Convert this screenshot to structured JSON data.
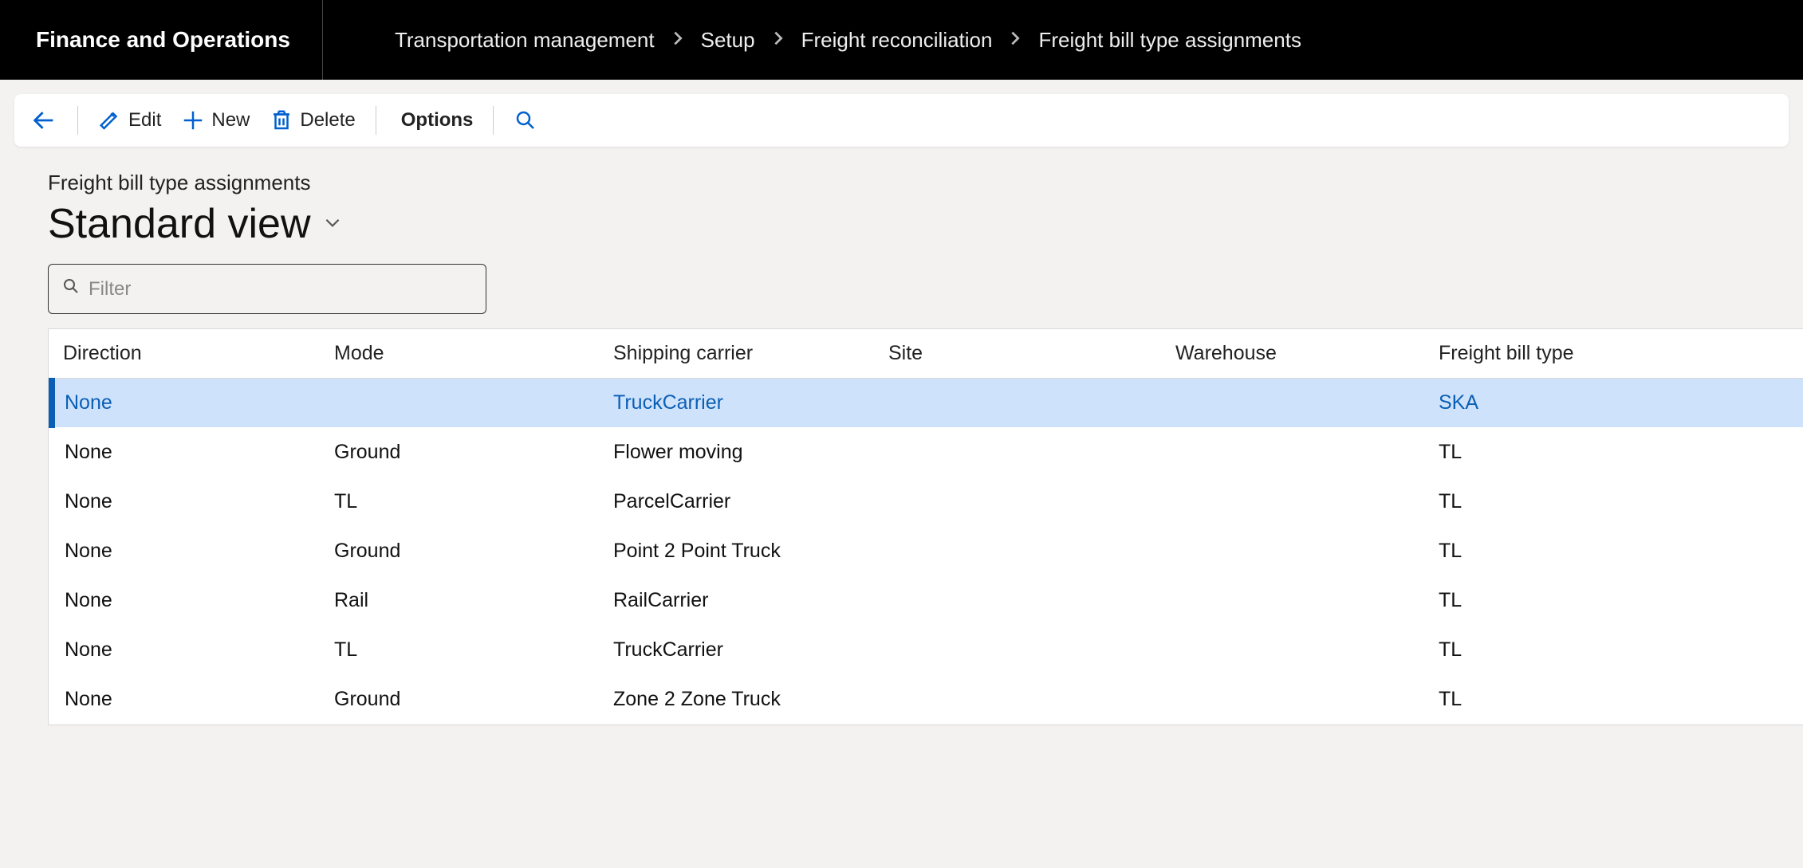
{
  "brand": "Finance and Operations",
  "breadcrumb": [
    "Transportation management",
    "Setup",
    "Freight reconciliation",
    "Freight bill type assignments"
  ],
  "actions": {
    "edit": "Edit",
    "new": "New",
    "delete": "Delete",
    "options": "Options"
  },
  "page": {
    "breadcrumb_line": "Freight bill type assignments",
    "title": "Standard view"
  },
  "filter": {
    "placeholder": "Filter"
  },
  "grid": {
    "columns": {
      "direction": "Direction",
      "mode": "Mode",
      "carrier": "Shipping carrier",
      "site": "Site",
      "warehouse": "Warehouse",
      "fbt": "Freight bill type"
    },
    "rows": [
      {
        "direction": "None",
        "mode": "",
        "carrier": "TruckCarrier",
        "site": "",
        "warehouse": "",
        "fbt": "SKA",
        "selected": true
      },
      {
        "direction": "None",
        "mode": "Ground",
        "carrier": "Flower moving",
        "site": "",
        "warehouse": "",
        "fbt": "TL"
      },
      {
        "direction": "None",
        "mode": "TL",
        "carrier": "ParcelCarrier",
        "site": "",
        "warehouse": "",
        "fbt": "TL"
      },
      {
        "direction": "None",
        "mode": "Ground",
        "carrier": "Point 2 Point Truck",
        "site": "",
        "warehouse": "",
        "fbt": "TL"
      },
      {
        "direction": "None",
        "mode": "Rail",
        "carrier": "RailCarrier",
        "site": "",
        "warehouse": "",
        "fbt": "TL"
      },
      {
        "direction": "None",
        "mode": "TL",
        "carrier": "TruckCarrier",
        "site": "",
        "warehouse": "",
        "fbt": "TL"
      },
      {
        "direction": "None",
        "mode": "Ground",
        "carrier": "Zone 2 Zone Truck",
        "site": "",
        "warehouse": "",
        "fbt": "TL"
      }
    ]
  }
}
